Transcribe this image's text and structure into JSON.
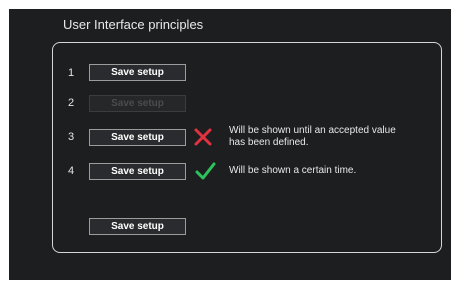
{
  "title": "User Interface principles",
  "rows": [
    {
      "number": "1",
      "button_label": "Save setup",
      "state": "enabled"
    },
    {
      "number": "2",
      "button_label": "Save setup",
      "state": "disabled"
    },
    {
      "number": "3",
      "button_label": "Save setup",
      "state": "enabled",
      "status_icon": "cross-icon",
      "note": "Will be shown until an accepted value has been defined."
    },
    {
      "number": "4",
      "button_label": "Save setup",
      "state": "enabled",
      "status_icon": "check-icon",
      "note": "Will be shown a certain time."
    }
  ],
  "bottom_button_label": "Save setup",
  "colors": {
    "background": "#1d1e20",
    "cross": "#e0323f",
    "check": "#2ec35a"
  }
}
